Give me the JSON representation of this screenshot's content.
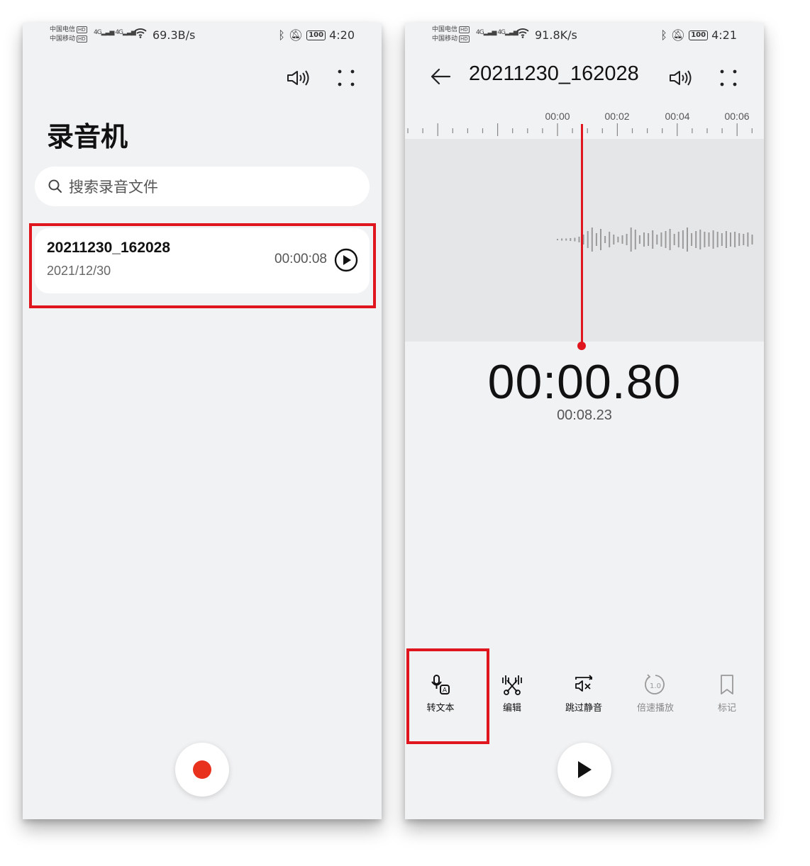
{
  "left": {
    "status": {
      "carrier1": "中国电信",
      "carrier2": "中国移动",
      "hd": "HD",
      "net": "4G",
      "speed": "69.3B/s",
      "battery": "100",
      "time": "4:20"
    },
    "app_title": "录音机",
    "search": {
      "placeholder": "搜索录音文件"
    },
    "recordings": [
      {
        "name": "20211230_162028",
        "date": "2021/12/30",
        "duration": "00:00:08"
      }
    ],
    "icons": {
      "speaker": "speaker-icon",
      "more": "more-dots-icon",
      "search": "search-icon",
      "play": "play-circle-icon",
      "record": "record-icon"
    }
  },
  "right": {
    "status": {
      "carrier1": "中国电信",
      "carrier2": "中国移动",
      "hd": "HD",
      "net": "4G",
      "speed": "91.8K/s",
      "battery": "100",
      "time": "4:21"
    },
    "file_title": "20211230_162028",
    "timeline_labels": [
      "00:00",
      "00:02",
      "00:04",
      "00:06"
    ],
    "current_time": "00:00.80",
    "total_time": "00:08.23",
    "tools": [
      {
        "label": "转文本",
        "icon": "speech-to-text-icon",
        "enabled": true
      },
      {
        "label": "编辑",
        "icon": "edit-scissors-icon",
        "enabled": true
      },
      {
        "label": "跳过静音",
        "icon": "skip-silence-icon",
        "enabled": true
      },
      {
        "label": "倍速播放",
        "icon": "playback-speed-icon",
        "speed": "1.0",
        "enabled": false
      },
      {
        "label": "标记",
        "icon": "bookmark-icon",
        "enabled": false
      }
    ]
  },
  "colors": {
    "accent_red": "#e0161f",
    "record_red": "#e8321e",
    "background": "#f1f2f4"
  }
}
